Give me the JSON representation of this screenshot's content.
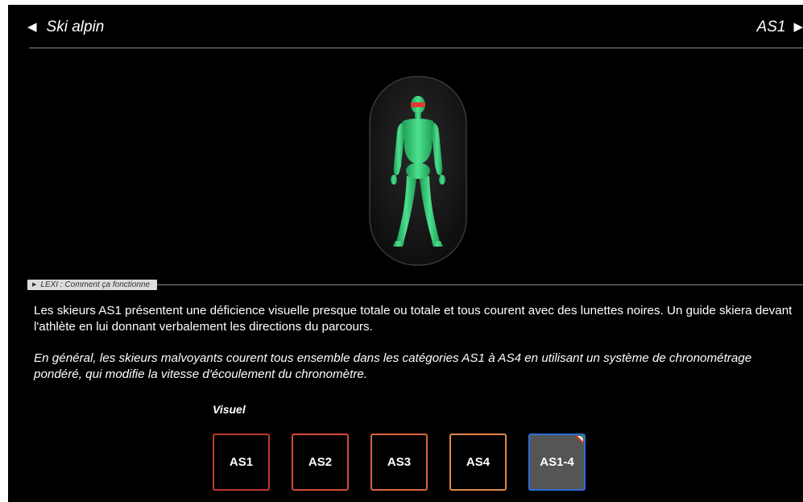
{
  "header": {
    "prev_label": "Ski alpin",
    "next_label": "AS1"
  },
  "lexi": {
    "label": "LEXI : Comment ça fonctionne"
  },
  "description": {
    "paragraph1": "Les skieurs AS1 présentent une déficience visuelle presque totale ou totale et tous courent avec des lunettes noires. Un guide skiera devant l'athlète en lui donnant verbalement les directions du parcours.",
    "paragraph2": "En général, les skieurs malvoyants courent tous ensemble dans les catégories AS1 à AS4 en utilisant un système de chronométrage pondéré, qui modifie la vitesse d'écoulement du chronomètre."
  },
  "classes": {
    "group_label": "Visuel",
    "items": [
      {
        "label": "AS1",
        "border_color": "#c0392b",
        "active": false
      },
      {
        "label": "AS2",
        "border_color": "#d24a36",
        "active": false
      },
      {
        "label": "AS3",
        "border_color": "#d9663a",
        "active": false
      },
      {
        "label": "AS4",
        "border_color": "#e0894a",
        "active": false
      },
      {
        "label": "AS1-4",
        "border_color": "#2f6fd6",
        "active": true
      }
    ]
  },
  "colors": {
    "background": "#000000",
    "body_green": "#2ecc71",
    "eye_band": "#e03a2a"
  }
}
